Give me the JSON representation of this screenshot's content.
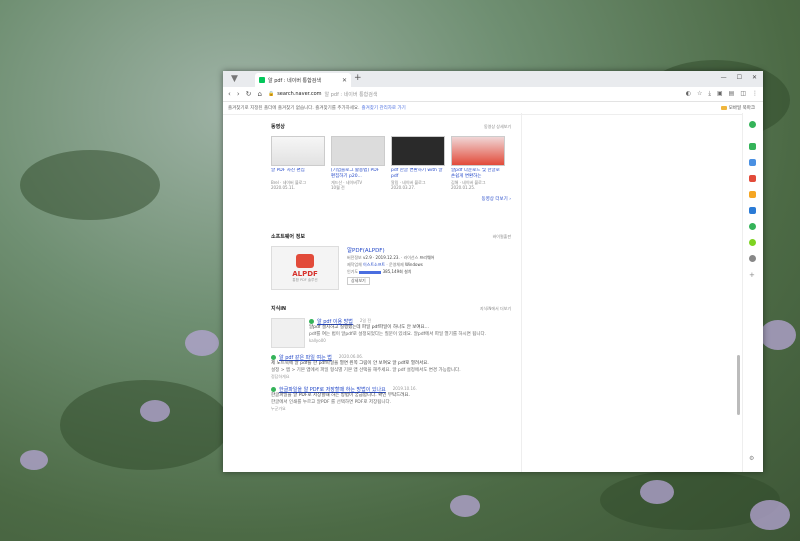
{
  "browser": {
    "tab_title": "알 pdf : 네이버 통합검색",
    "url_domain": "search.naver.com",
    "url_rest": "알 pdf : 네이버 통합검색",
    "bookmark_hint": "즐겨찾기로 지정된 폴더에 즐겨찾기 없습니다. 즐겨찾기를 추가하세요.",
    "bookmark_link": "즐겨찾기 관리자로 가기",
    "mobile_bookmark": "모바일 북마크"
  },
  "video": {
    "header": "동영상",
    "more": "동영상 상세보기",
    "items": [
      {
        "title": "알 PDF 사진 편집",
        "channel": "Brel · 네이버 블로그",
        "date": "2020.05.11."
      },
      {
        "title": "[기업블로그 활용법] PDF 편집하기 p20...",
        "channel": "게드산 · 네이버TV",
        "date": "10월 전"
      },
      {
        "title": "pdf 한글 변환하기 with 알pdf",
        "channel": "알림 · 네이버 블로그",
        "date": "2020.03.27."
      },
      {
        "title": "알pdf 다운로드 및 한글로 손쉽게 변환하는",
        "channel": "김해 · 네이버 블로그",
        "date": "2020.01.25."
      }
    ],
    "more_link": "동영상 더보기 ›"
  },
  "software": {
    "header": "소프트웨어 정보",
    "more": "바이럴출판",
    "name": "알PDF(ALPDF)",
    "logo": "ALPDF",
    "logo_sub": "통합 PDF 솔루션",
    "version_label": "버전정보",
    "version": "v2.9 · 2019.12.23.",
    "license_label": "라이선스",
    "license": "프리웨어",
    "maker_label": "제작업체",
    "maker": "이스트소프트",
    "os_label": "운영체제",
    "os": "Windows",
    "popular_label": "인기도",
    "downloads": "385,149회 설치",
    "button": "상세보기"
  },
  "kin": {
    "header": "지식iN",
    "more": "지식iN에서 더보기",
    "items": [
      {
        "q": "알 pdf 이용 방법",
        "date": "2일 전",
        "p": "알pdf 설치하고 실행했는데 파일 pdf파일이 하나도 안 보여요...",
        "a": "pdf를 여는 법이 알pdf로 설정되었다는 질문이 있네요. 알pdf에서 파일 열기를 하시면 됩니다.",
        "src": "kallyo00"
      },
      {
        "q": "알 pdf 같은 파일 여는 법",
        "date": "2020.06.06.",
        "p": "제 노트북에 알 pdf를 한 pdf파일을 열면 왼쪽 그림이 안 보여요 알 pdf로 열려서요.",
        "a": "설정 > 앱 > 기본 앱에서 파일 형식별 기본 앱 선택을 해주세요. 알 pdf 설정에서도 변경 가능합니다.",
        "src": "정답하게요"
      },
      {
        "q": "한글파일을 알 PDF로 저장할때 하는 방법이 있나요",
        "date": "2019.10.16.",
        "p": "한글파일을 알 PDF로 저장할때 하는 방법이 궁금합니다. 확인 부탁드려요.",
        "a": "한글에서 인쇄를 누르고 알PDF 를 선택하면 PDF로 저장됩니다.",
        "src": "누군가요"
      }
    ]
  }
}
